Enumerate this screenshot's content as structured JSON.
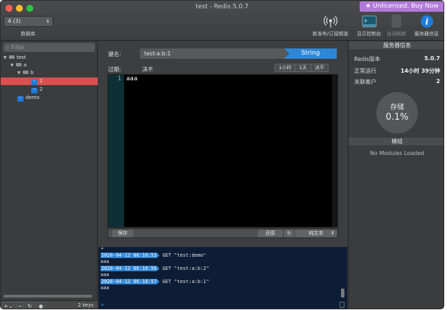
{
  "window": {
    "title": "test - Redis 5.0.7",
    "unlicensed_label": "★ Unlicensed. Buy Now"
  },
  "toolbar": {
    "db_select": {
      "value": "4 (3)",
      "label": "数据库"
    },
    "buttons": [
      {
        "label": "新发布/订阅频道",
        "icon": "antenna-icon"
      },
      {
        "label": "显示控制台",
        "icon": "console-icon"
      },
      {
        "label": "自动刷新",
        "icon": "refresh-doc-icon"
      },
      {
        "label": "服务器信息",
        "icon": "info-icon"
      }
    ]
  },
  "sidebar": {
    "filter_placeholder": "Filter",
    "tree": [
      {
        "label": "test",
        "type": "folder",
        "depth": 0
      },
      {
        "label": "a",
        "type": "folder",
        "depth": 1
      },
      {
        "label": "b",
        "type": "folder",
        "depth": 2
      },
      {
        "label": "1",
        "type": "key",
        "depth": 3,
        "selected": true
      },
      {
        "label": "2",
        "type": "key",
        "depth": 3
      },
      {
        "label": "demo",
        "type": "key",
        "depth": 1
      }
    ],
    "footer": {
      "keys_count": "2 keys"
    }
  },
  "editor": {
    "key_label": "键名:",
    "key_value": "test:a:b:1",
    "type": "String",
    "ttl_label": "过期:",
    "ttl_value": "决不",
    "ttl_buttons": [
      "1小时",
      "1天",
      "决不"
    ],
    "line_number": "1",
    "content": "aaa",
    "save_label": "保存",
    "revert_label": "还原",
    "format_label": "纯文本"
  },
  "server_info": {
    "header": "服务器信息",
    "rows": [
      {
        "label": "Redis版本",
        "value": "5.0.7"
      },
      {
        "label": "正常运行",
        "value": "14小时 39分钟"
      },
      {
        "label": "关联客户",
        "value": "2"
      }
    ],
    "storage_label": "存储",
    "storage_value": "0.1%",
    "modules_header": "模组",
    "modules_empty": "No Modules Loaded"
  },
  "log": {
    "first_line": "1",
    "entries": [
      {
        "time": "2020-04-12 06:16:53",
        "cmd": "GET \"test:demo\"",
        "result": "aaa"
      },
      {
        "time": "2020-04-12 06:16:56",
        "cmd": "GET \"test:a:b:2\"",
        "result": "aaa"
      },
      {
        "time": "2020-04-12 06:16:57",
        "cmd": "GET \"test:a:b:1\"",
        "result": "aaa"
      }
    ],
    "prompt": ">"
  },
  "colors": {
    "accent": "#2f86d6",
    "selection": "#d9504f",
    "unlicensed": "#b27ad8"
  }
}
